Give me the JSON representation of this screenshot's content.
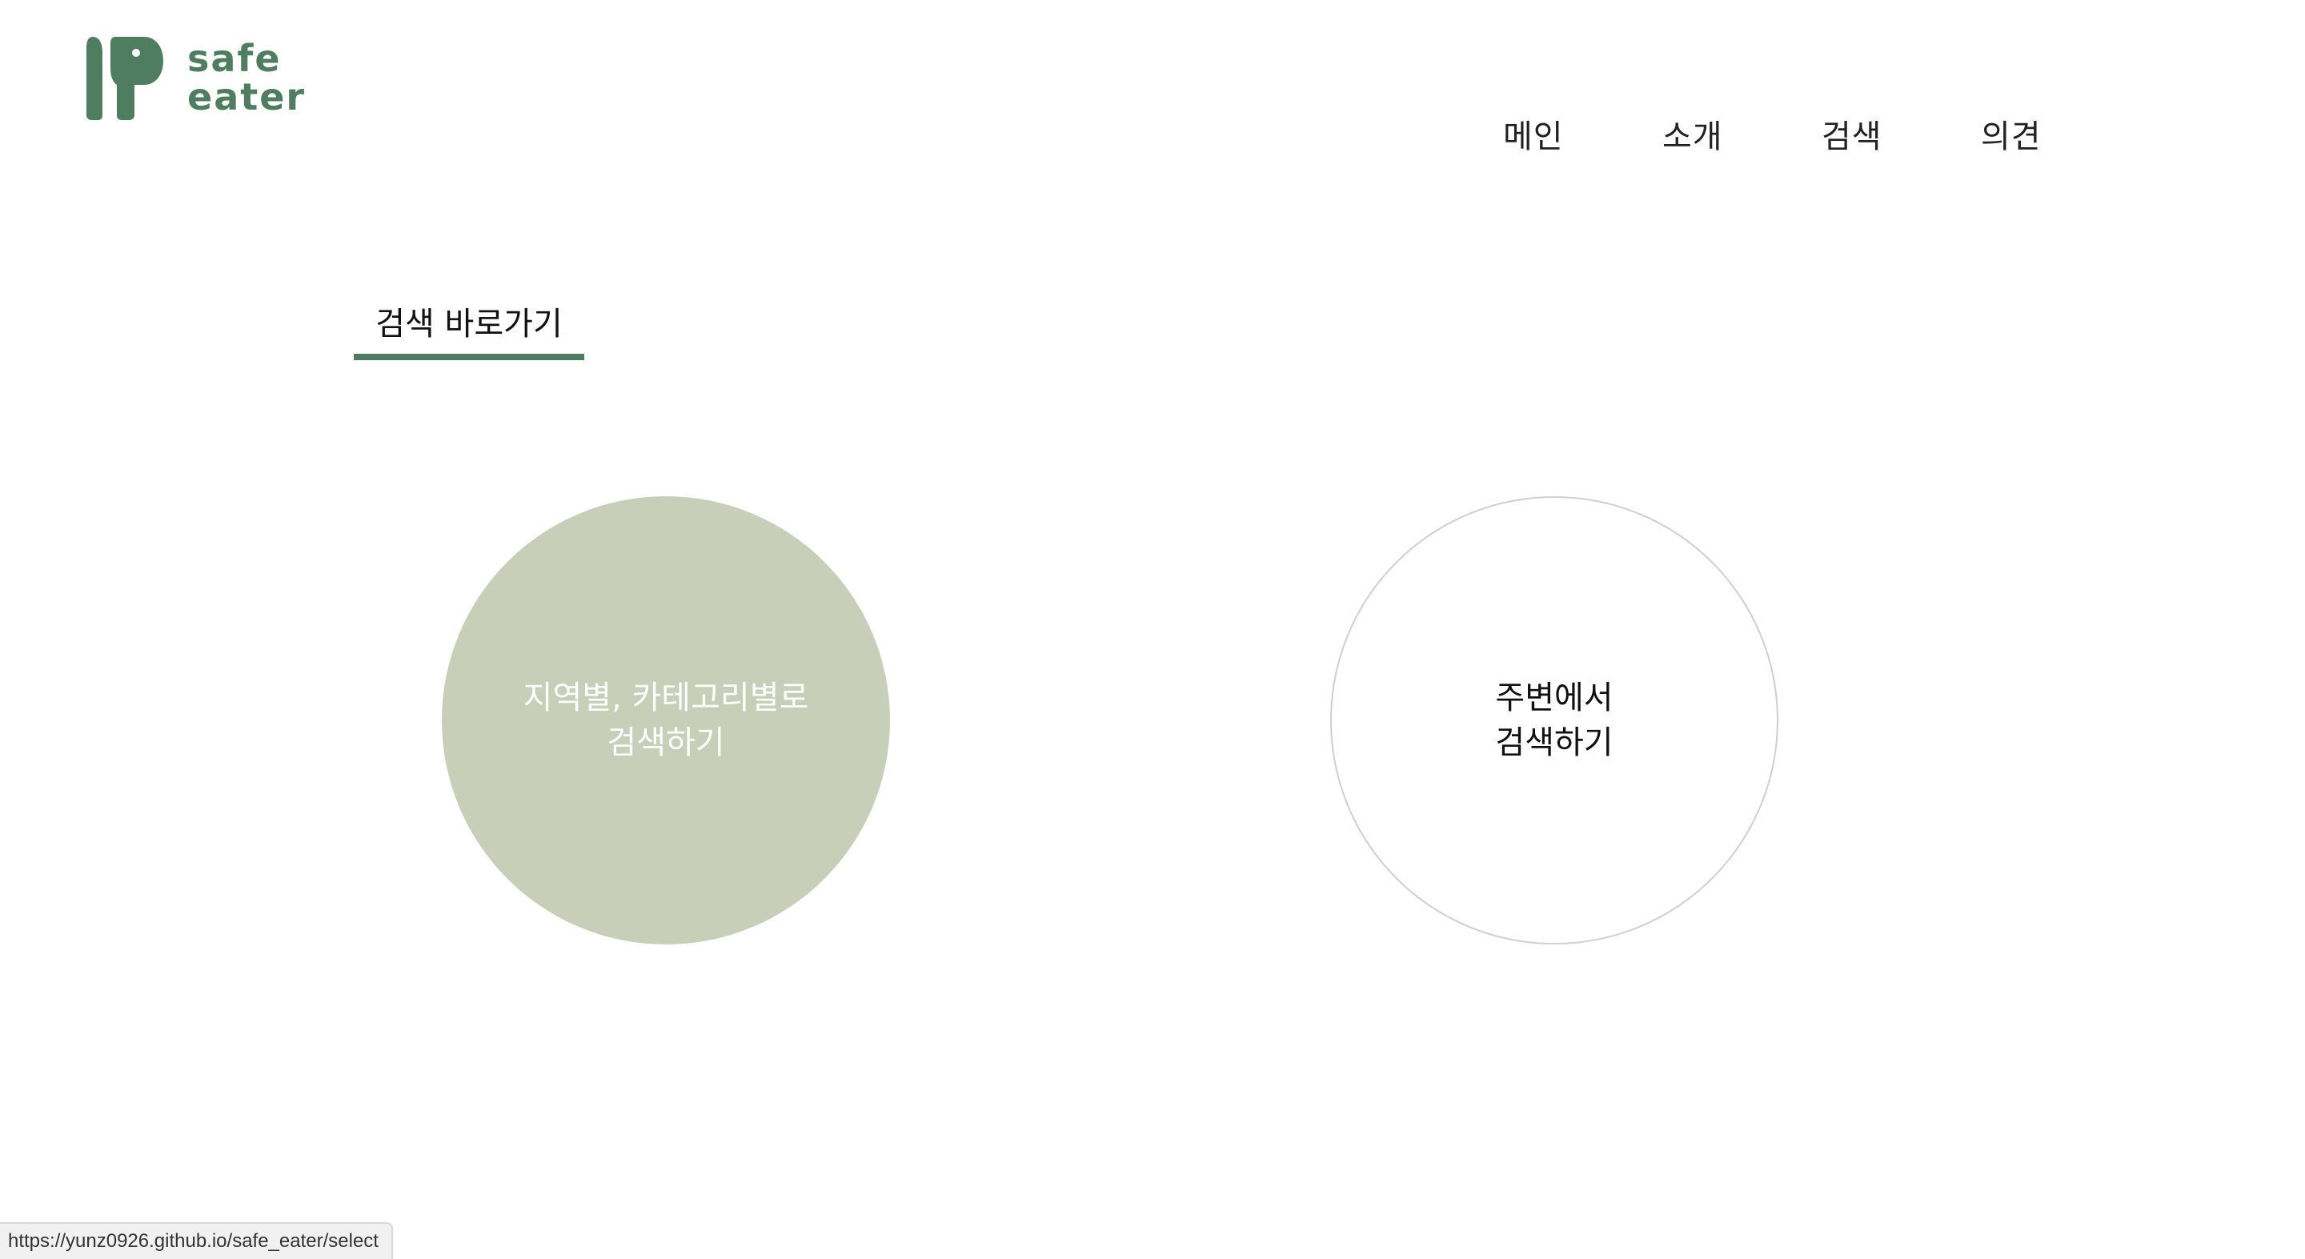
{
  "logo": {
    "line1": "safe",
    "line2": "eater",
    "icon": "elephant-logo-icon",
    "color": "#4f7d5f"
  },
  "nav": {
    "items": [
      {
        "label": "메인"
      },
      {
        "label": "소개"
      },
      {
        "label": "검색"
      },
      {
        "label": "의견"
      }
    ]
  },
  "section": {
    "title": "검색 바로가기",
    "accent": "#4f7d5f"
  },
  "options": {
    "region": {
      "line1": "지역별, 카테고리별로",
      "line2": "검색하기",
      "fill": "#c7cfb9"
    },
    "nearby": {
      "line1": "주변에서",
      "line2": "검색하기"
    }
  },
  "status": {
    "url": "https://yunz0926.github.io/safe_eater/select"
  }
}
